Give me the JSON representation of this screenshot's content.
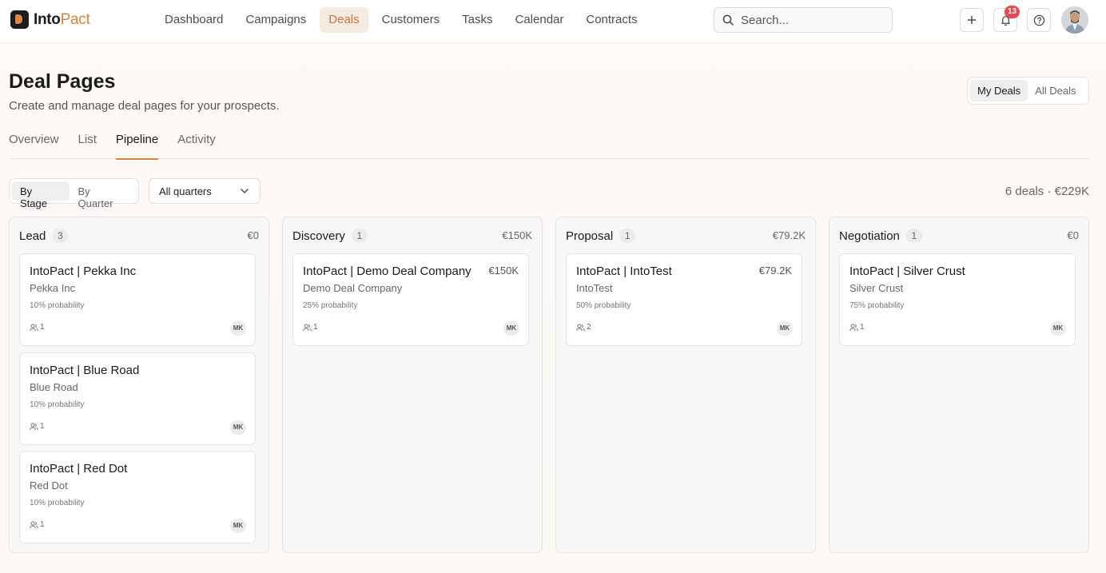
{
  "app": {
    "brand_a": "Into",
    "brand_b": "Pact"
  },
  "nav": {
    "items": [
      {
        "label": "Dashboard",
        "active": false
      },
      {
        "label": "Campaigns",
        "active": false
      },
      {
        "label": "Deals",
        "active": true
      },
      {
        "label": "Customers",
        "active": false
      },
      {
        "label": "Tasks",
        "active": false
      },
      {
        "label": "Calendar",
        "active": false
      },
      {
        "label": "Contracts",
        "active": false
      }
    ]
  },
  "search": {
    "placeholder": "Search..."
  },
  "notifications": {
    "count": "13"
  },
  "header": {
    "title": "Deal Pages",
    "subtitle": "Create and manage deal pages for your prospects.",
    "my_deals": "My Deals",
    "all_deals": "All Deals"
  },
  "tabs": [
    {
      "label": "Overview",
      "active": false
    },
    {
      "label": "List",
      "active": false
    },
    {
      "label": "Pipeline",
      "active": true
    },
    {
      "label": "Activity",
      "active": false
    }
  ],
  "filters": {
    "by_stage": "By Stage",
    "by_quarter": "By Quarter",
    "quarter_selected": "All quarters",
    "summary": "6 deals · €229K"
  },
  "columns": [
    {
      "title": "Lead",
      "count": "3",
      "total": "€0",
      "cards": [
        {
          "title": "IntoPact | Pekka Inc",
          "amount": "",
          "company": "Pekka Inc",
          "probability": "10% probability",
          "members": "1",
          "owner": "MK"
        },
        {
          "title": "IntoPact | Blue Road",
          "amount": "",
          "company": "Blue Road",
          "probability": "10% probability",
          "members": "1",
          "owner": "MK"
        },
        {
          "title": "IntoPact | Red Dot",
          "amount": "",
          "company": "Red Dot",
          "probability": "10% probability",
          "members": "1",
          "owner": "MK"
        }
      ]
    },
    {
      "title": "Discovery",
      "count": "1",
      "total": "€150K",
      "cards": [
        {
          "title": "IntoPact | Demo Deal Company",
          "amount": "€150K",
          "company": "Demo Deal Company",
          "probability": "25% probability",
          "members": "1",
          "owner": "MK"
        }
      ]
    },
    {
      "title": "Proposal",
      "count": "1",
      "total": "€79.2K",
      "cards": [
        {
          "title": "IntoPact | IntoTest",
          "amount": "€79.2K",
          "company": "IntoTest",
          "probability": "50% probability",
          "members": "2",
          "owner": "MK"
        }
      ]
    },
    {
      "title": "Negotiation",
      "count": "1",
      "total": "€0",
      "cards": [
        {
          "title": "IntoPact | Silver Crust",
          "amount": "",
          "company": "Silver Crust",
          "probability": "75% probability",
          "members": "1",
          "owner": "MK"
        }
      ]
    }
  ]
}
